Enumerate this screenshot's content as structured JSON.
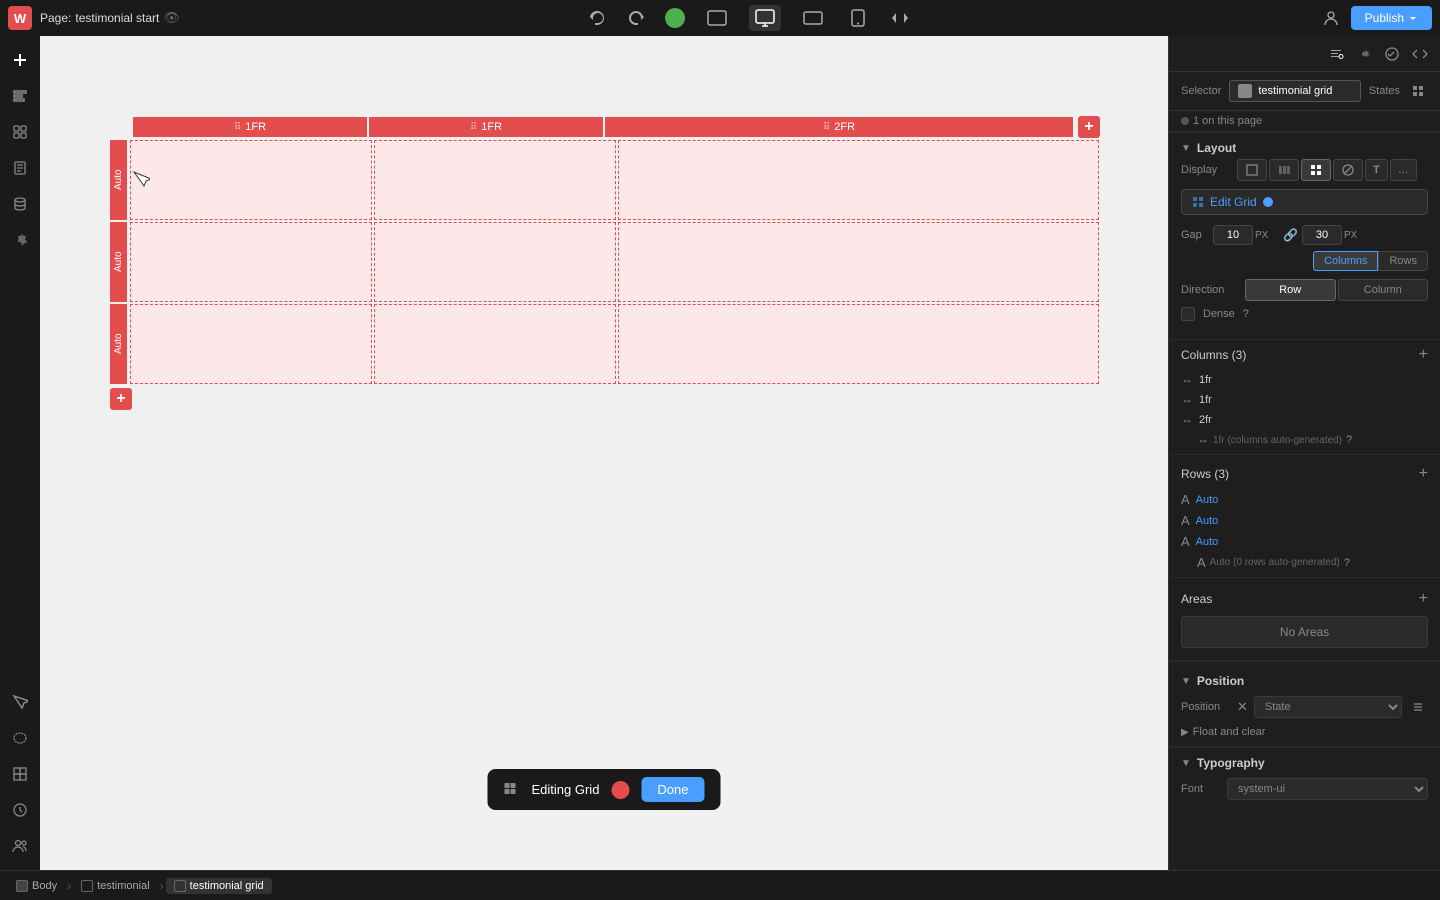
{
  "topbar": {
    "logo": "W",
    "page_label": "Page:",
    "page_name": "testimonial start",
    "publish_label": "Publish",
    "devices": [
      {
        "id": "desktop-large",
        "label": "Desktop Large"
      },
      {
        "id": "desktop",
        "label": "Desktop",
        "active": true
      },
      {
        "id": "tablet-landscape",
        "label": "Tablet Landscape"
      },
      {
        "id": "mobile",
        "label": "Mobile"
      }
    ]
  },
  "right_panel": {
    "selector_label": "Selector",
    "selector_name": "testimonial grid",
    "states_label": "States",
    "instance_label": "1 on this page",
    "layout": {
      "section_title": "Layout",
      "display_label": "Display",
      "display_options": [
        {
          "id": "block",
          "icon": "▣"
        },
        {
          "id": "flex",
          "icon": "⊞"
        },
        {
          "id": "grid",
          "icon": "⊟",
          "active": true
        },
        {
          "id": "none",
          "icon": "⊘"
        },
        {
          "id": "text",
          "icon": "T"
        },
        {
          "id": "more",
          "icon": "…"
        }
      ],
      "edit_grid_label": "Edit Grid",
      "gap_label": "Gap",
      "gap_col_value": "10",
      "gap_col_unit": "PX",
      "gap_row_value": "30",
      "gap_row_unit": "PX",
      "gap_tabs": [
        "Columns",
        "Rows"
      ],
      "active_gap_tab": "Columns",
      "direction_label": "Direction",
      "direction_options": [
        "Row",
        "Column"
      ],
      "active_direction": "Row",
      "dense_label": "Dense"
    },
    "columns": {
      "title": "Columns (3)",
      "items": [
        {
          "value": "1fr"
        },
        {
          "value": "1fr"
        },
        {
          "value": "2fr"
        }
      ],
      "auto_label": "1fr (columns auto-generated)"
    },
    "rows": {
      "title": "Rows (3)",
      "items": [
        {
          "value": "Auto"
        },
        {
          "value": "Auto"
        },
        {
          "value": "Auto"
        }
      ],
      "auto_label": "Auto (0 rows auto-generated)"
    },
    "areas": {
      "title": "Areas",
      "no_areas_label": "No Areas"
    },
    "position": {
      "title": "Position",
      "position_label": "Position",
      "state_placeholder": "State",
      "float_label": "Float and clear"
    },
    "typography": {
      "title": "Typography",
      "font_label": "Font",
      "font_value": "system-ui"
    }
  },
  "grid": {
    "columns": [
      {
        "label": "1FR"
      },
      {
        "label": "1FR"
      },
      {
        "label": "2FR"
      }
    ],
    "rows": [
      {
        "label": "Auto"
      },
      {
        "label": "Auto"
      },
      {
        "label": "Auto"
      }
    ]
  },
  "editing_toolbar": {
    "label": "Editing Grid",
    "done_label": "Done"
  },
  "breadcrumb": {
    "items": [
      {
        "label": "Body",
        "icon": "body"
      },
      {
        "label": "testimonial",
        "icon": "div"
      },
      {
        "label": "testimonial grid",
        "icon": "div",
        "active": true
      }
    ]
  }
}
